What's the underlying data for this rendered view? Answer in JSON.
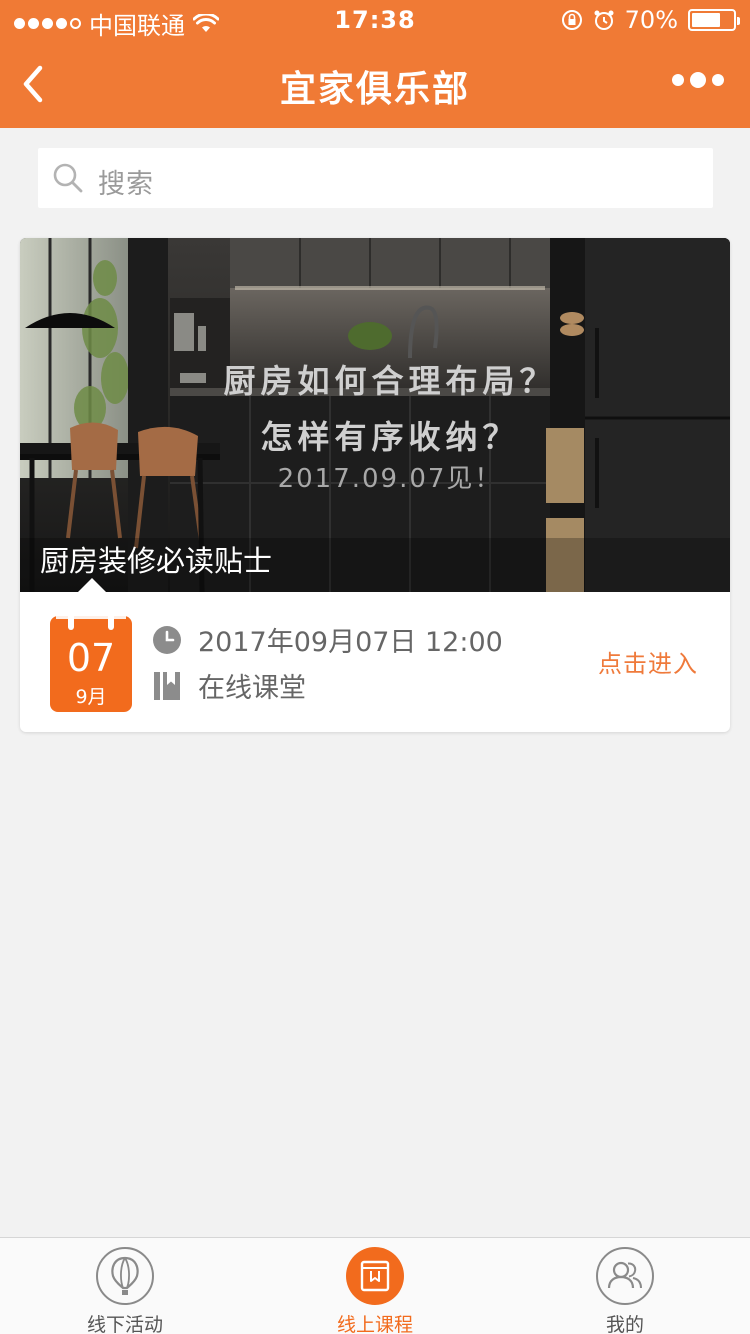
{
  "status_bar": {
    "carrier": "中国联通",
    "time": "17:38",
    "battery": "70%",
    "battery_level": 0.7
  },
  "nav": {
    "title": "宜家俱乐部",
    "back_icon": "chevron-left-icon",
    "more_icon": "more-dots-icon"
  },
  "search": {
    "placeholder": "搜索",
    "icon": "search-icon"
  },
  "course_card": {
    "banner_line1": "厨房如何合理布局？",
    "banner_line2": "怎样有序收纳？",
    "banner_line3": "2017.09.07见！",
    "caption": "厨房装修必读贴士",
    "date_day": "07",
    "date_month": "9月",
    "datetime": "2017年09月07日 12:00",
    "location": "在线课堂",
    "enter_label": "点击进入"
  },
  "tabbar": {
    "items": [
      {
        "label": "线下活动",
        "icon": "balloon-icon",
        "active": false
      },
      {
        "label": "线上课程",
        "icon": "course-icon",
        "active": true
      },
      {
        "label": "我的",
        "icon": "user-group-icon",
        "active": false
      }
    ]
  },
  "colors": {
    "brand_orange": "#f07a35",
    "calendar_orange": "#f26b1d",
    "background": "#f2f2f2"
  }
}
